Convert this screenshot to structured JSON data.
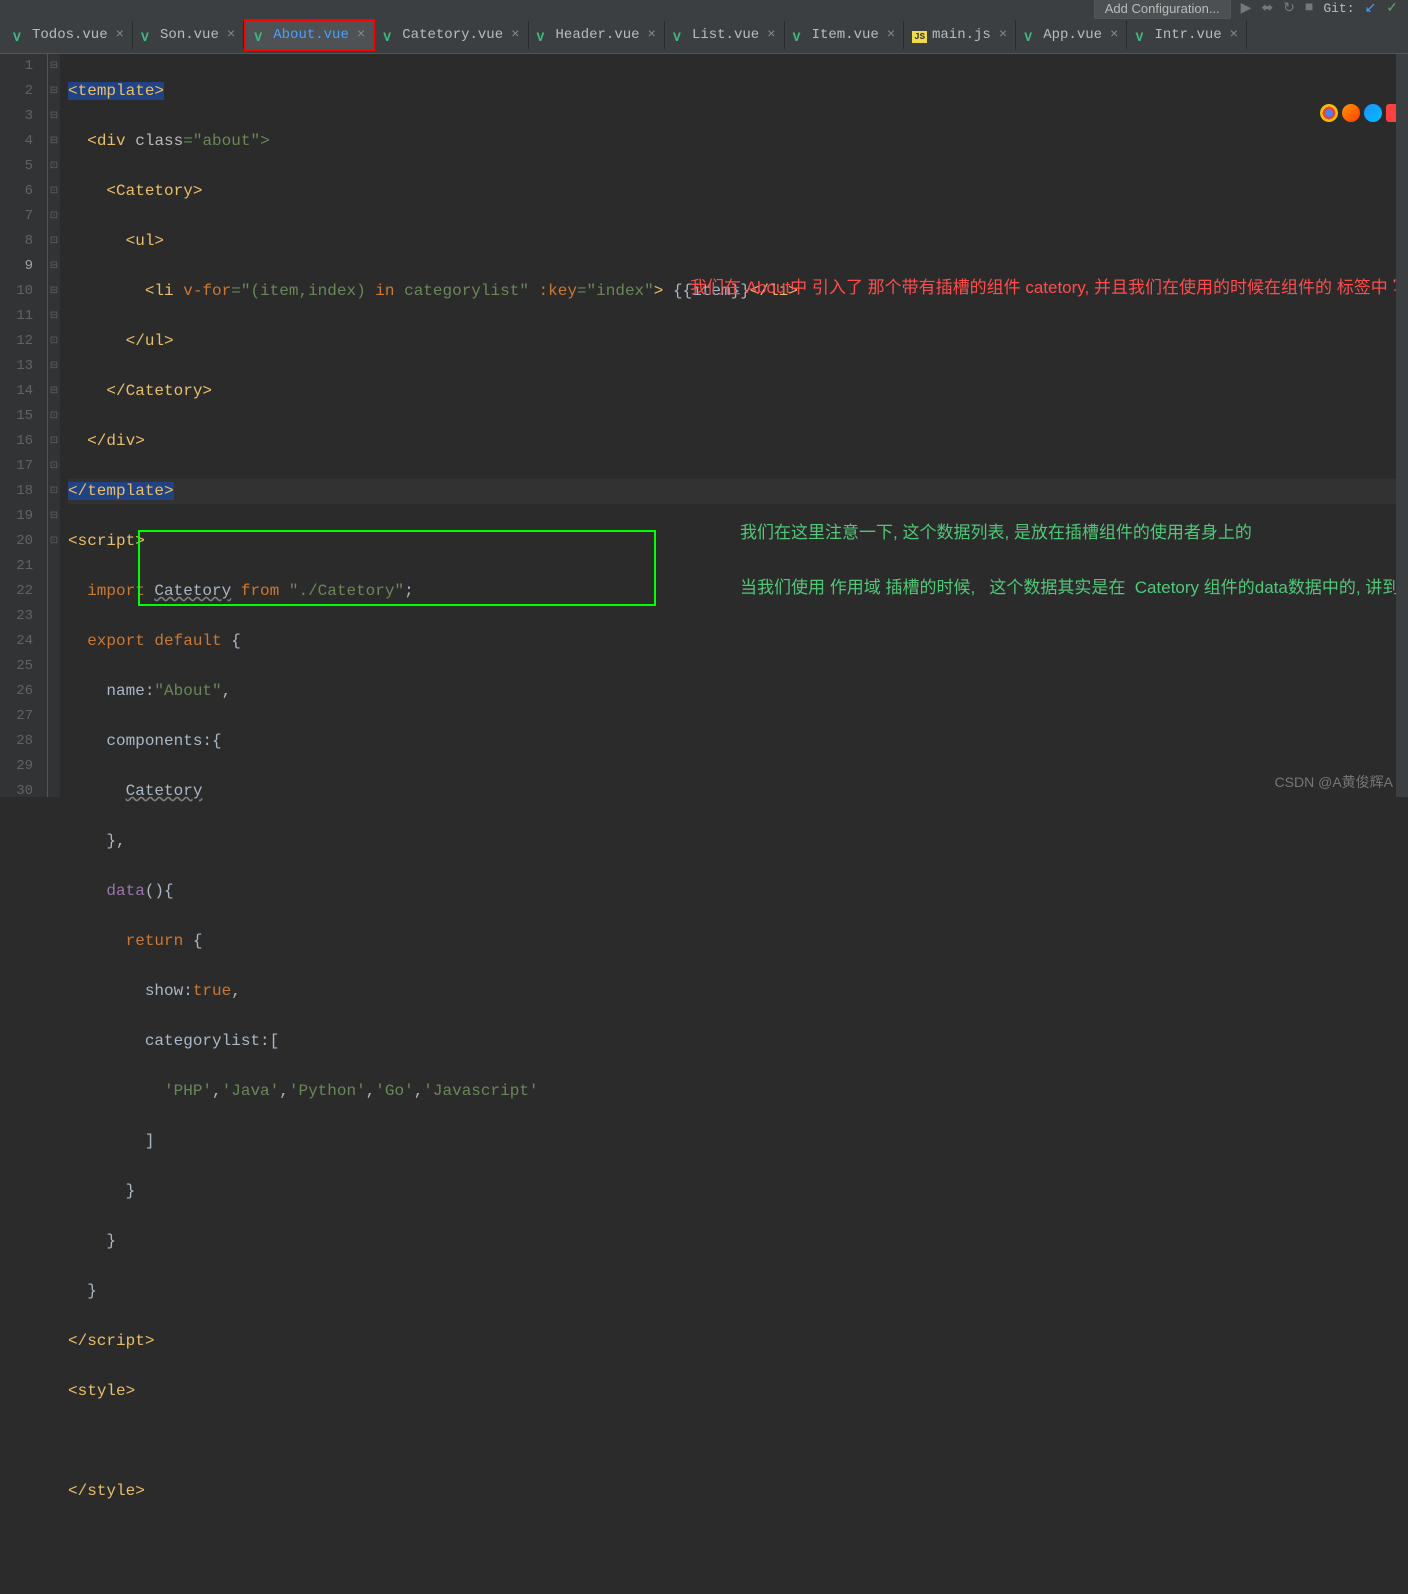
{
  "toolbar": {
    "config_label": "Add Configuration...",
    "git_label": "Git:"
  },
  "tabs": [
    {
      "name": "Todos.vue",
      "icon": "vue"
    },
    {
      "name": "Son.vue",
      "icon": "vue"
    },
    {
      "name": "About.vue",
      "icon": "vue",
      "active": true,
      "highlighted": true
    },
    {
      "name": "Catetory.vue",
      "icon": "vue"
    },
    {
      "name": "Header.vue",
      "icon": "vue"
    },
    {
      "name": "List.vue",
      "icon": "vue"
    },
    {
      "name": "Item.vue",
      "icon": "vue"
    },
    {
      "name": "main.js",
      "icon": "js"
    },
    {
      "name": "App.vue",
      "icon": "vue"
    },
    {
      "name": "Intr.vue",
      "icon": "vue"
    }
  ],
  "gutter_lines": [
    "1",
    "2",
    "3",
    "4",
    "5",
    "6",
    "7",
    "8",
    "9",
    "10",
    "11",
    "12",
    "13",
    "14",
    "15",
    "16",
    "17",
    "18",
    "19",
    "20",
    "21",
    "22",
    "23",
    "24",
    "25",
    "26",
    "27",
    "28",
    "29",
    "30"
  ],
  "current_line": 9,
  "code": {
    "l1": {
      "open": "<",
      "tag": "template",
      "close": ">"
    },
    "l2": {
      "open": "<",
      "tag": "div",
      "sp": " ",
      "attr": "class",
      "eq": "=\"",
      "val": "about",
      "close": "\">"
    },
    "l3": {
      "open": "<",
      "tag": "Catetory",
      "close": ">"
    },
    "l4": {
      "open": "<",
      "tag": "ul",
      "close": ">"
    },
    "l5": {
      "open": "<",
      "tag": "li",
      "sp": " ",
      "dir": "v-for",
      "eq": "=\"",
      "val1": "(item,index) ",
      "kw": "in",
      "val2": " categorylist",
      "q": "\"",
      "sp2": " ",
      "key": ":key",
      "eq2": "=\"",
      "val3": "index",
      "q2": "\"",
      "close": ">",
      "sp3": " ",
      "mo": "{{",
      "item": "item",
      "mc": "}}",
      "ctag": "</",
      "ctagn": "li",
      "cclose": ">"
    },
    "l6": {
      "open": "</",
      "tag": "ul",
      "close": ">"
    },
    "l7": {
      "open": "</",
      "tag": "Catetory",
      "close": ">"
    },
    "l8": {
      "open": "</",
      "tag": "div",
      "close": ">"
    },
    "l9": {
      "open": "</",
      "tag": "template",
      "close": ">"
    },
    "l10": {
      "open": "<",
      "tag": "script",
      "close": ">"
    },
    "l11": {
      "kw": "import",
      "sp": " ",
      "id": "Catetory",
      "sp2": " ",
      "from": "from",
      "sp3": " ",
      "str": "\"./Catetory\"",
      "semi": ";"
    },
    "l12": {
      "kw": "export",
      "sp": " ",
      "def": "default",
      "sp2": " ",
      "brace": "{"
    },
    "l13": {
      "prop": "name",
      "colon": ":",
      "str": "\"About\"",
      "comma": ","
    },
    "l14": {
      "prop": "components",
      "colon": ":",
      "brace": "{"
    },
    "l15": {
      "id": "Catetory"
    },
    "l16": {
      "brace": "}",
      "comma": ","
    },
    "l17": {
      "prop": "data",
      "paren": "()",
      "brace": "{"
    },
    "l18": {
      "kw": "return",
      "sp": " ",
      "brace": "{"
    },
    "l19": {
      "prop": "show",
      "colon": ":",
      "val": "true",
      "comma": ","
    },
    "l20": {
      "prop": "categorylist",
      "colon": ":",
      "bracket": "["
    },
    "l21": {
      "s1": "'PHP'",
      "c1": ",",
      "s2": "'Java'",
      "c2": ",",
      "s3": "'Python'",
      "c3": ",",
      "s4": "'Go'",
      "c4": ",",
      "s5": "'Javascript'"
    },
    "l22": {
      "bracket": "]"
    },
    "l23": {
      "brace": "}"
    },
    "l24": {
      "brace": "}"
    },
    "l25": {
      "brace": "}"
    },
    "l26": {
      "open": "</",
      "tag": "script",
      "close": ">"
    },
    "l27": {
      "open": "<",
      "tag": "style",
      "close": ">"
    },
    "l29": {
      "open": "</",
      "tag": "style",
      "close": ">"
    }
  },
  "annotations": {
    "red": "我们在 About中 引入了 那个带有插槽的组件 catetory, 并且我们在使用的时候在组件的 标签中 写入的  ul li的结构, 此时, 我们写入的 ul 结构就会, 自动是替换  catetory 中的  slot 插槽部分的代码, 这就是默认 插槽的使用",
    "green1": "我们在这里注意一下, 这个数据列表, 是放在插槽组件的使用者身上的",
    "green2": "当我们使用 作用域 插槽的时候,   这个数据其实是在  Catetory 组件的data数据中的, 讲到作用域插槽的时候再说"
  },
  "watermark": "CSDN @A黄俊辉A"
}
